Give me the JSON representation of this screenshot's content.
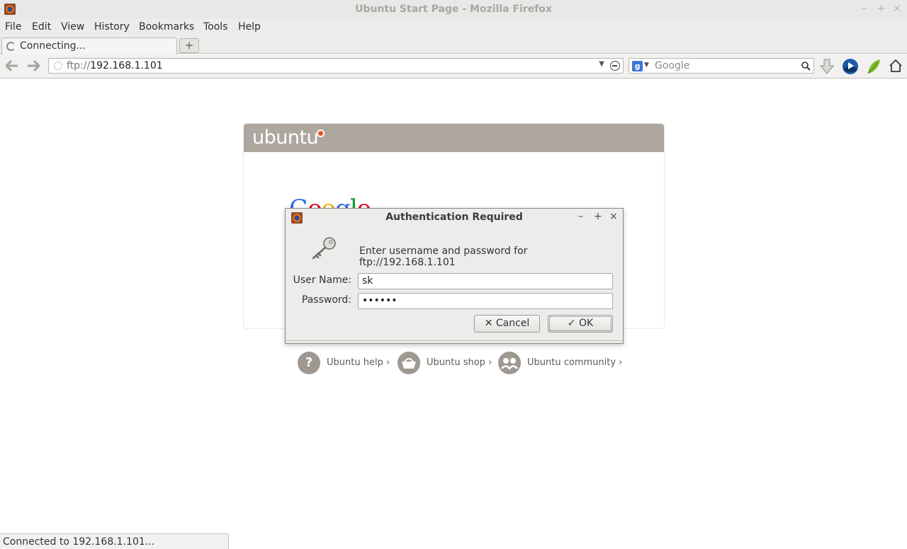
{
  "window": {
    "title": "Ubuntu Start Page - Mozilla Firefox",
    "controls": {
      "minimize": "–",
      "maximize": "+",
      "close": "×"
    }
  },
  "menu": [
    "File",
    "Edit",
    "View",
    "History",
    "Bookmarks",
    "Tools",
    "Help"
  ],
  "tab": {
    "label": "Connecting...",
    "new_tab": "+"
  },
  "nav": {
    "url_scheme": "ftp://",
    "url_host": "192.168.1.101",
    "search_placeholder": "Google",
    "search_engine_letter": "g"
  },
  "page": {
    "brand": "ubuntu",
    "google_peek": "Google",
    "links": [
      {
        "label": "Ubuntu help ›",
        "icon": "question-icon"
      },
      {
        "label": "Ubuntu shop ›",
        "icon": "basket-icon"
      },
      {
        "label": "Ubuntu community ›",
        "icon": "community-icon"
      }
    ]
  },
  "status": "Connected to 192.168.1.101...",
  "dialog": {
    "title": "Authentication Required",
    "controls": {
      "minimize": "–",
      "maximize": "+",
      "close": "×"
    },
    "message": "Enter username and password for ftp://192.168.1.101",
    "username_label": "User Name:",
    "username_value": "sk",
    "password_label": "Password:",
    "password_value": "••••••",
    "cancel_label": "Cancel",
    "ok_label": "OK"
  }
}
